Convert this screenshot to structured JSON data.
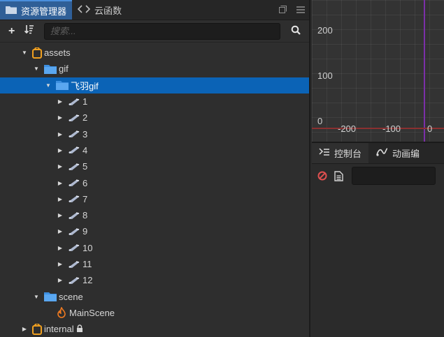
{
  "tabs": {
    "asset_manager": "资源管理器",
    "cloud_functions": "云函数"
  },
  "toolbar": {
    "add_label": "+",
    "search_placeholder": "搜索..."
  },
  "tree": [
    {
      "label": "assets",
      "depth": 0,
      "expanded": true,
      "type": "assets-root"
    },
    {
      "label": "gif",
      "depth": 1,
      "expanded": true,
      "type": "folder"
    },
    {
      "label": "飞羽gif",
      "depth": 2,
      "expanded": true,
      "type": "folder",
      "selected": true
    },
    {
      "label": "1",
      "depth": 3,
      "expanded": false,
      "type": "sprite"
    },
    {
      "label": "2",
      "depth": 3,
      "expanded": false,
      "type": "sprite"
    },
    {
      "label": "3",
      "depth": 3,
      "expanded": false,
      "type": "sprite"
    },
    {
      "label": "4",
      "depth": 3,
      "expanded": false,
      "type": "sprite"
    },
    {
      "label": "5",
      "depth": 3,
      "expanded": false,
      "type": "sprite"
    },
    {
      "label": "6",
      "depth": 3,
      "expanded": false,
      "type": "sprite"
    },
    {
      "label": "7",
      "depth": 3,
      "expanded": false,
      "type": "sprite"
    },
    {
      "label": "8",
      "depth": 3,
      "expanded": false,
      "type": "sprite"
    },
    {
      "label": "9",
      "depth": 3,
      "expanded": false,
      "type": "sprite"
    },
    {
      "label": "10",
      "depth": 3,
      "expanded": false,
      "type": "sprite"
    },
    {
      "label": "11",
      "depth": 3,
      "expanded": false,
      "type": "sprite"
    },
    {
      "label": "12",
      "depth": 3,
      "expanded": false,
      "type": "sprite"
    },
    {
      "label": "scene",
      "depth": 1,
      "expanded": true,
      "type": "folder"
    },
    {
      "label": "MainScene",
      "depth": 2,
      "expanded": null,
      "type": "scene-file"
    },
    {
      "label": "internal",
      "depth": 0,
      "expanded": false,
      "type": "assets-root",
      "locked": true
    }
  ],
  "scene_view": {
    "y_labels": [
      "200",
      "100",
      "0"
    ],
    "x_labels": [
      "-200",
      "-100",
      "0"
    ]
  },
  "console": {
    "tab_console": "控制台",
    "tab_animation": "动画编"
  },
  "colors": {
    "selection": "#0b63b6",
    "active_tab": "#2f5f97",
    "folder": "#3d8fe0",
    "assets_icon": "#f0a020",
    "y_axis": "#7b2fa8",
    "x_axis": "#8a3030",
    "clear_icon": "#e05050"
  }
}
